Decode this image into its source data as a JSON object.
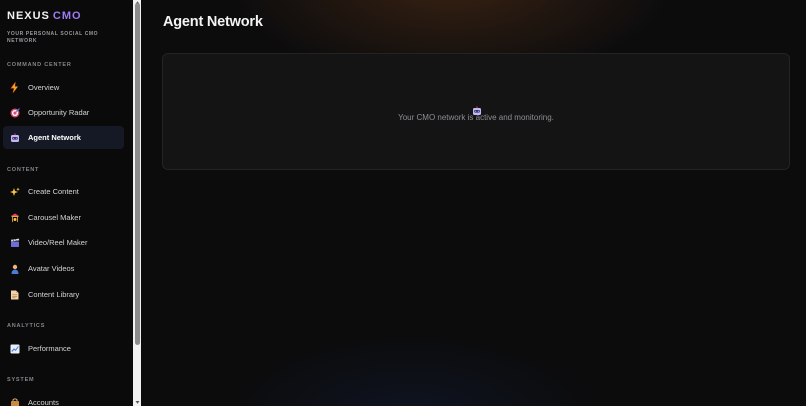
{
  "brand": {
    "name": "NEXUS",
    "accent": "CMO",
    "tagline": "YOUR PERSONAL SOCIAL CMO NETWORK"
  },
  "sidebar": {
    "sections": [
      {
        "label": "COMMAND CENTER",
        "items": [
          {
            "label": "Overview",
            "icon": "lightning-icon"
          },
          {
            "label": "Opportunity Radar",
            "icon": "target-icon"
          },
          {
            "label": "Agent Network",
            "icon": "robot-icon",
            "active": true
          }
        ]
      },
      {
        "label": "CONTENT",
        "items": [
          {
            "label": "Create Content",
            "icon": "sparkles-icon"
          },
          {
            "label": "Carousel Maker",
            "icon": "carousel-icon"
          },
          {
            "label": "Video/Reel Maker",
            "icon": "clapper-icon"
          },
          {
            "label": "Avatar Videos",
            "icon": "person-icon"
          },
          {
            "label": "Content Library",
            "icon": "document-icon"
          }
        ]
      },
      {
        "label": "ANALYTICS",
        "items": [
          {
            "label": "Performance",
            "icon": "chart-icon"
          }
        ]
      },
      {
        "label": "SYSTEM",
        "items": [
          {
            "label": "Accounts",
            "icon": "link-icon"
          }
        ]
      }
    ]
  },
  "main": {
    "title": "Agent Network",
    "status_message": "Your CMO network is active and monitoring.",
    "status_icon": "robot-icon"
  },
  "colors": {
    "accent": "#9b7cf0",
    "active_bg": "#151925",
    "background": "#0c0c0d"
  }
}
